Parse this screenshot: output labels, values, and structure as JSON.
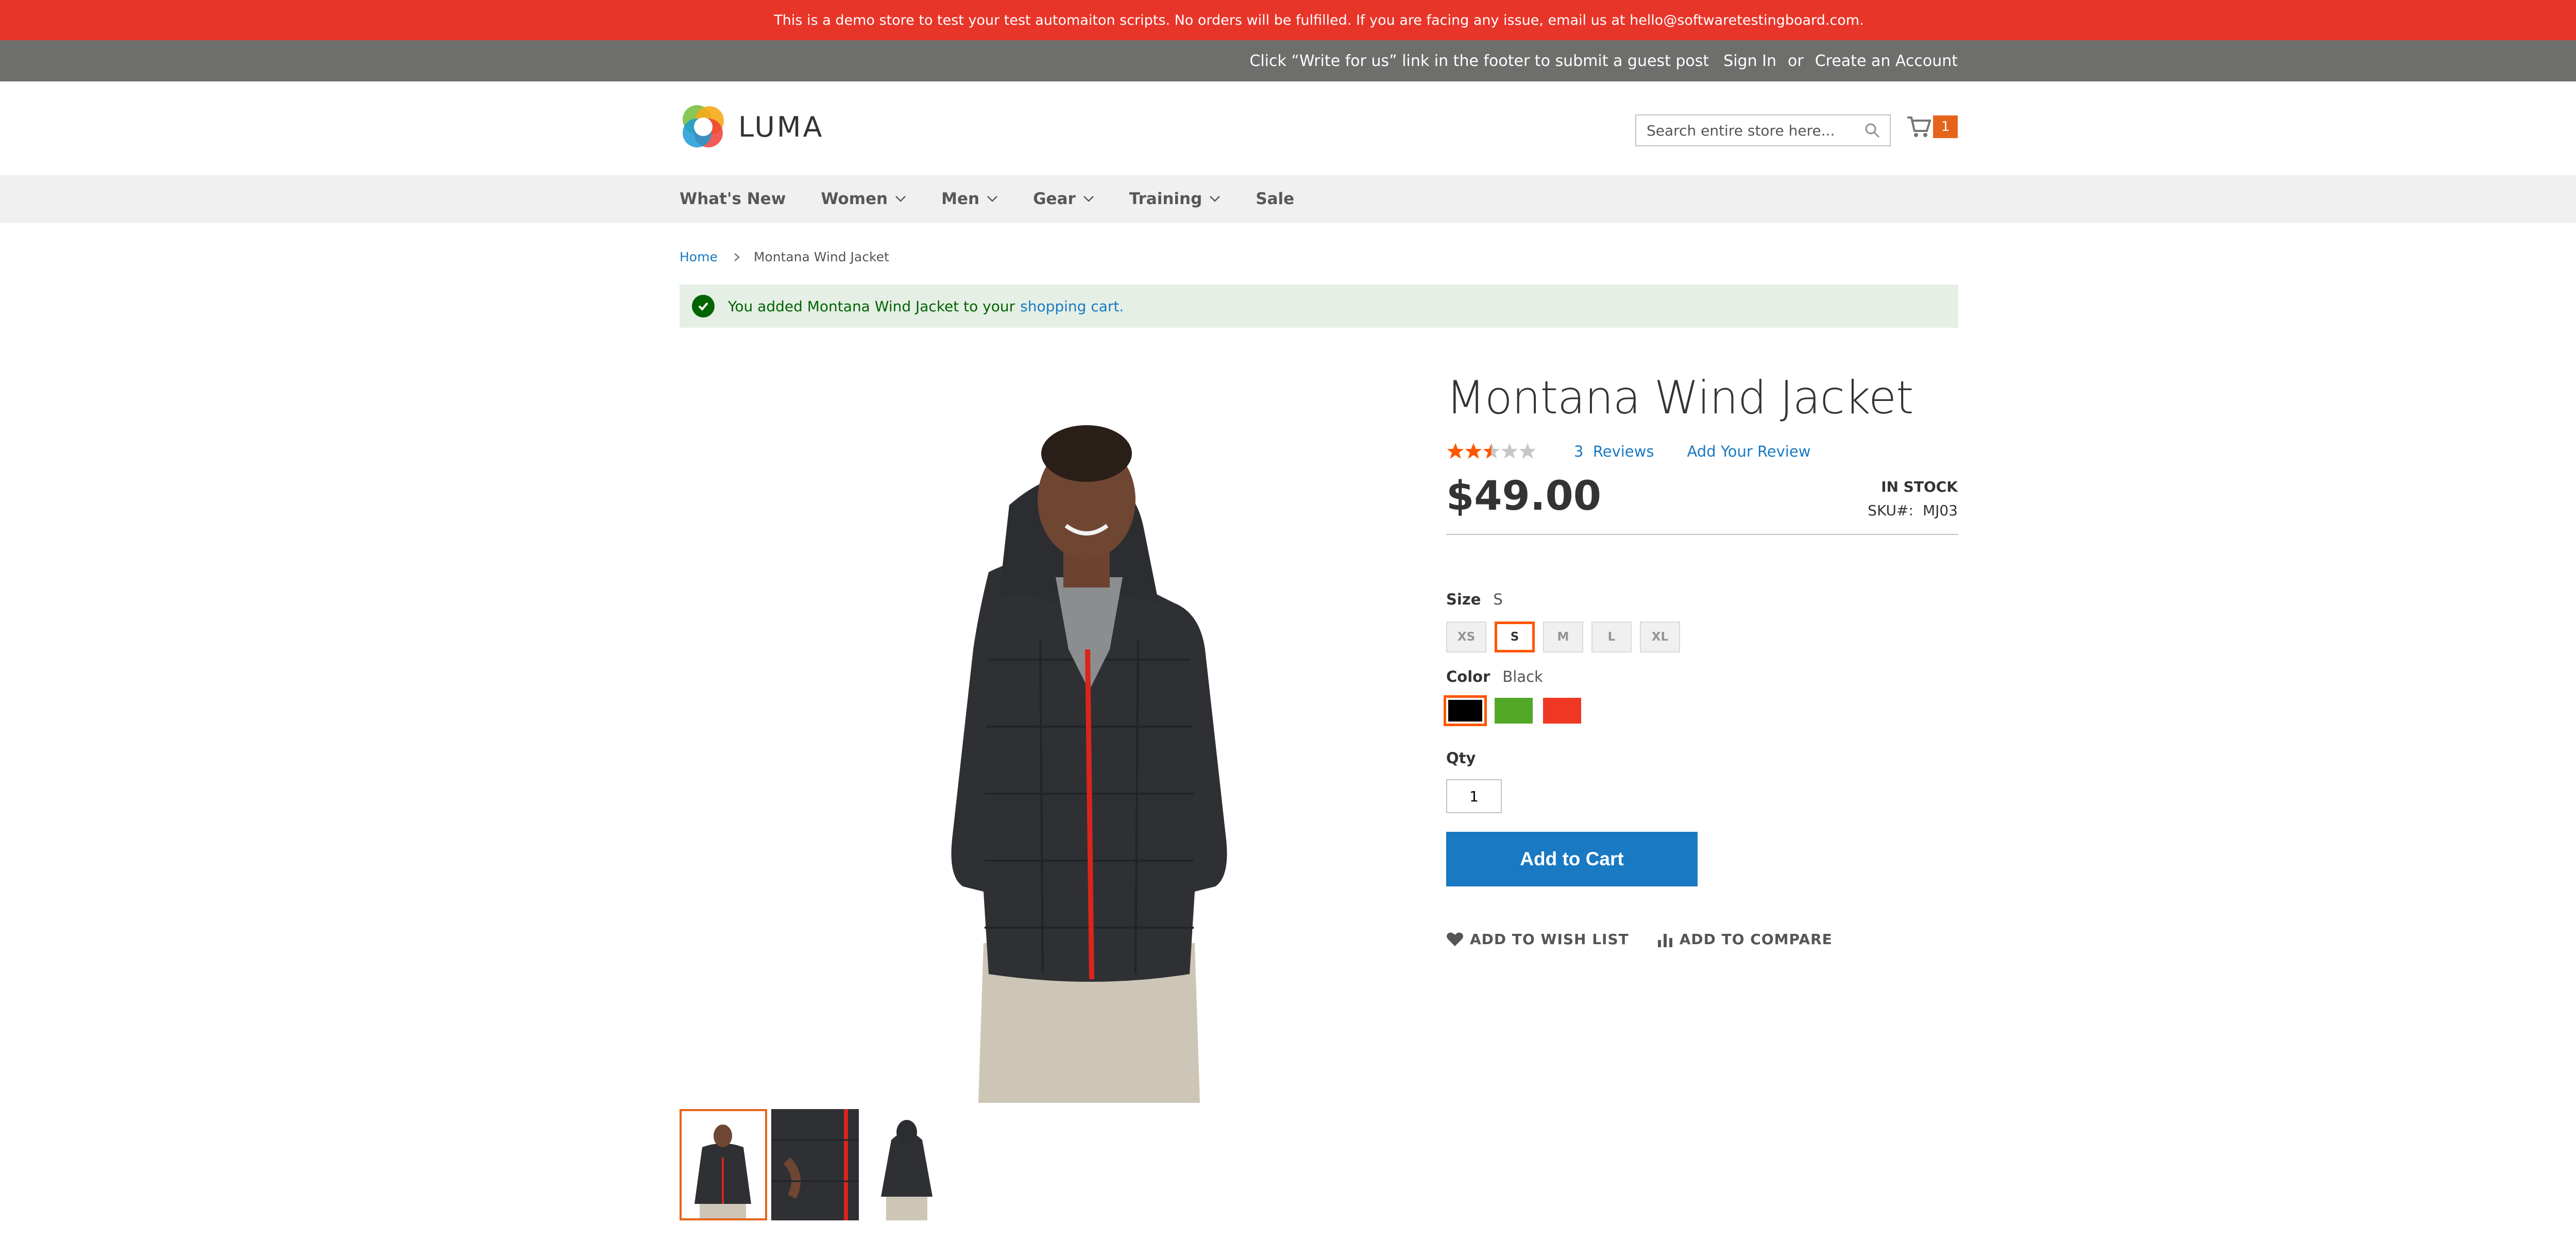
{
  "notice": "This is a demo store to test your test automaiton scripts. No orders will be fulfilled. If you are facing any issue, email us at hello@softwaretestingboard.com.",
  "top_links": {
    "write_for_us": "Click “Write for us” link in the footer to submit a guest post",
    "sign_in": "Sign In",
    "or": "or",
    "create_account": "Create an Account"
  },
  "header": {
    "logo_text": "LUMA",
    "search_placeholder": "Search entire store here...",
    "cart_count": "1"
  },
  "nav": {
    "whats_new": "What's New",
    "women": "Women",
    "men": "Men",
    "gear": "Gear",
    "training": "Training",
    "sale": "Sale"
  },
  "breadcrumb": {
    "home": "Home",
    "current": "Montana Wind Jacket"
  },
  "message": {
    "text": "You added Montana Wind Jacket to your",
    "link": "shopping cart."
  },
  "product": {
    "title": "Montana Wind Jacket",
    "rating_percent": 50,
    "reviews_count": "3",
    "reviews_label": "Reviews",
    "add_review": "Add Your Review",
    "price": "$49.00",
    "stock": "IN STOCK",
    "sku_label": "SKU#:",
    "sku": "MJ03",
    "size_label": "Size",
    "size_selected": "S",
    "sizes": [
      "XS",
      "S",
      "M",
      "L",
      "XL"
    ],
    "color_label": "Color",
    "color_selected": "Black",
    "colors": [
      "#000000",
      "#53a828",
      "#ef3823"
    ],
    "qty_label": "Qty",
    "qty": "1",
    "add_to_cart": "Add to Cart",
    "wishlist": "ADD TO WISH LIST",
    "compare": "ADD TO COMPARE"
  },
  "colors": {
    "notice_bg": "#e8352a",
    "toplinks_bg": "#6e6e6c",
    "accent_orange": "#e5641c",
    "link_blue": "#1979c3",
    "success_bg": "#e5efe5"
  }
}
